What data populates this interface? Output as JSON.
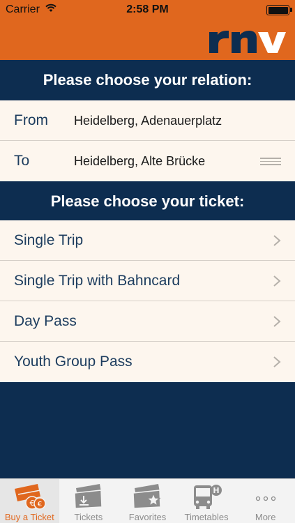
{
  "status_bar": {
    "carrier": "Carrier",
    "time": "2:58 PM"
  },
  "brand": {
    "logo_text": "rnv",
    "accent": "#e0671e",
    "navy": "#0d2d50"
  },
  "relation": {
    "title": "Please choose your relation:",
    "from_label": "From",
    "from_value": "Heidelberg, Adenauerplatz",
    "to_label": "To",
    "to_value": "Heidelberg, Alte Brücke"
  },
  "tickets": {
    "title": "Please choose your ticket:",
    "items": [
      {
        "label": "Single Trip"
      },
      {
        "label": "Single Trip with Bahncard"
      },
      {
        "label": "Day Pass"
      },
      {
        "label": "Youth Group Pass"
      }
    ]
  },
  "tabbar": {
    "items": [
      {
        "label": "Buy a Ticket",
        "icon": "buy-ticket-icon",
        "active": true
      },
      {
        "label": "Tickets",
        "icon": "tickets-icon"
      },
      {
        "label": "Favorites",
        "icon": "favorites-icon"
      },
      {
        "label": "Timetables",
        "icon": "bus-icon"
      },
      {
        "label": "More",
        "icon": "more-icon"
      }
    ]
  }
}
